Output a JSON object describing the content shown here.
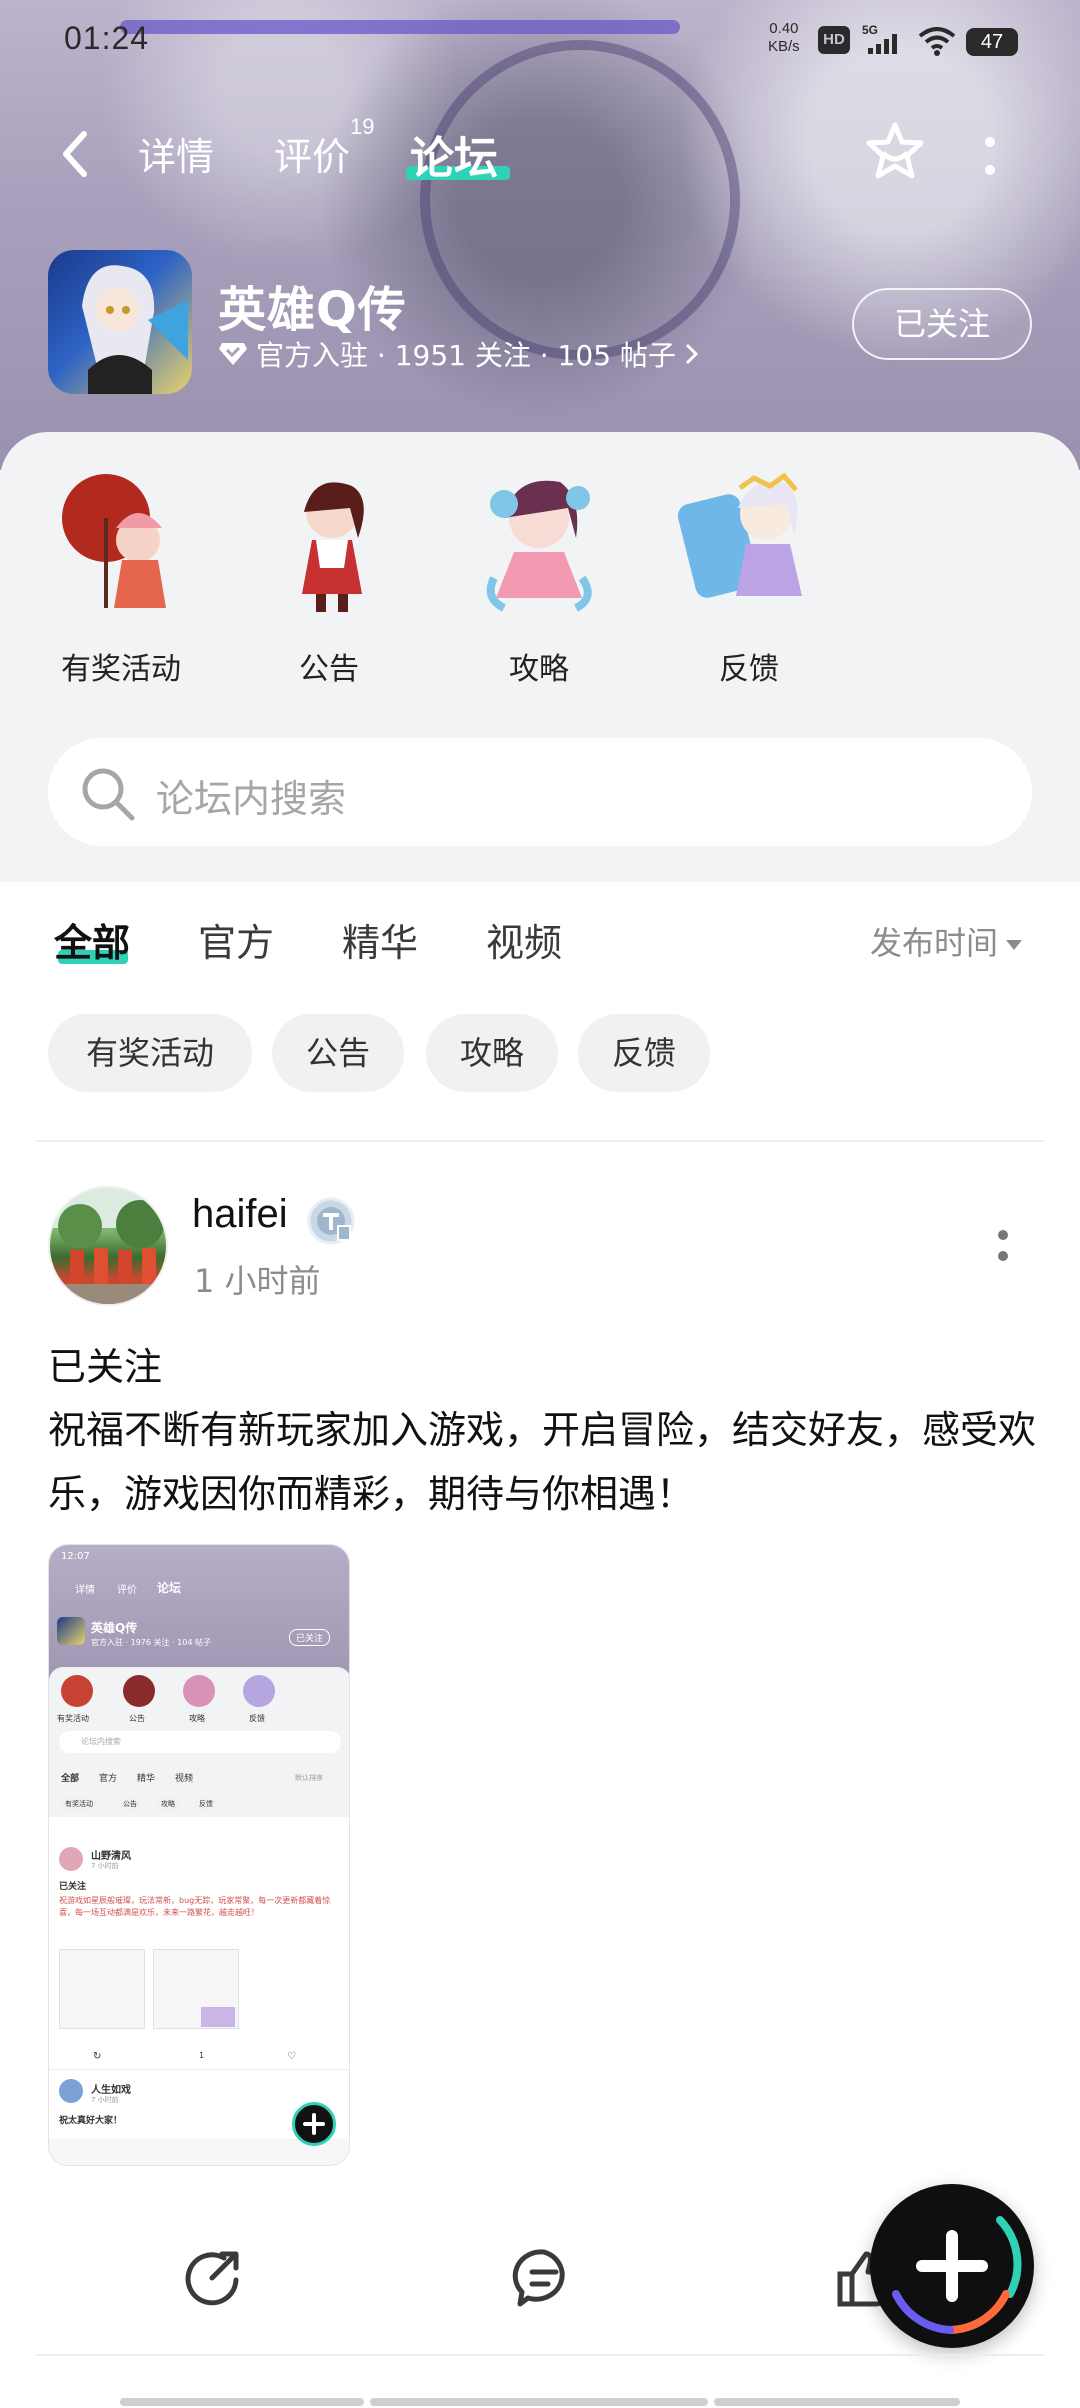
{
  "status_bar": {
    "time": "01:24",
    "net_speed_value": "0.40",
    "net_speed_unit": "KB/s",
    "hd": "HD",
    "network": "5G",
    "battery": "47"
  },
  "nav": {
    "tabs": [
      {
        "label": "详情"
      },
      {
        "label": "评价",
        "badge": "19"
      },
      {
        "label": "论坛",
        "active": true
      }
    ]
  },
  "game": {
    "name": "英雄Q传",
    "meta": "官方入驻 · 1951 关注 · 105 帖子",
    "follow_label": "已关注"
  },
  "categories": [
    {
      "label": "有奖活动"
    },
    {
      "label": "公告"
    },
    {
      "label": "攻略"
    },
    {
      "label": "反馈"
    }
  ],
  "search": {
    "placeholder": "论坛内搜索"
  },
  "filter_tabs": [
    {
      "label": "全部",
      "active": true
    },
    {
      "label": "官方"
    },
    {
      "label": "精华"
    },
    {
      "label": "视频"
    }
  ],
  "sort": {
    "label": "发布时间"
  },
  "chips": [
    "有奖活动",
    "公告",
    "攻略",
    "反馈"
  ],
  "post": {
    "username": "haifei",
    "time": "1 小时前",
    "title": "已关注",
    "body": "祝福不断有新玩家加入游戏，开启冒险，结交好友，感受欢乐，游戏因你而精彩，期待与你相遇！"
  },
  "thumbnail": {
    "time": "12:07",
    "nav": [
      "详情",
      "评价",
      "论坛"
    ],
    "game_name": "英雄Q传",
    "meta": "官方入驻 · 1976 关注 · 104 帖子",
    "follow": "已关注",
    "categories": [
      "有奖活动",
      "公告",
      "攻略",
      "反馈"
    ],
    "search": "论坛内搜索",
    "tabs": [
      "全部",
      "官方",
      "精华",
      "视频"
    ],
    "sort": "默认排序",
    "chips": [
      "有奖活动",
      "公告",
      "攻略",
      "反馈"
    ],
    "post1_user": "山野清风",
    "post1_time": "7 小时前",
    "post1_title": "已关注",
    "post1_body": "祝游戏如星辰般璀璨，玩法常新，bug无踪，玩家常聚，每一次更新都藏着惊喜，每一场互动都满是欢乐，未来一路繁花，越走越旺！",
    "comment_count": "1",
    "post2_user": "人生如戏",
    "post2_time": "7 小时前",
    "post2_title": "祝太真好大家！"
  },
  "colors": {
    "accent": "#2fd1b7",
    "header_bg": "#a79fbb",
    "sheet_bg": "#f2f3f5"
  },
  "icons": [
    "back-icon",
    "star-icon",
    "more-icon",
    "verified-icon",
    "search-icon",
    "share-icon",
    "comment-icon",
    "like-icon",
    "plus-icon"
  ]
}
